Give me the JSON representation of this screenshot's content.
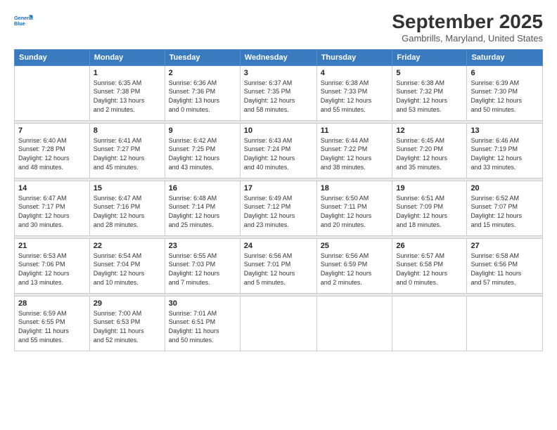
{
  "logo": {
    "line1": "General",
    "line2": "Blue"
  },
  "title": "September 2025",
  "subtitle": "Gambrills, Maryland, United States",
  "weekdays": [
    "Sunday",
    "Monday",
    "Tuesday",
    "Wednesday",
    "Thursday",
    "Friday",
    "Saturday"
  ],
  "weeks": [
    [
      {
        "day": "",
        "info": ""
      },
      {
        "day": "1",
        "info": "Sunrise: 6:35 AM\nSunset: 7:38 PM\nDaylight: 13 hours\nand 2 minutes."
      },
      {
        "day": "2",
        "info": "Sunrise: 6:36 AM\nSunset: 7:36 PM\nDaylight: 13 hours\nand 0 minutes."
      },
      {
        "day": "3",
        "info": "Sunrise: 6:37 AM\nSunset: 7:35 PM\nDaylight: 12 hours\nand 58 minutes."
      },
      {
        "day": "4",
        "info": "Sunrise: 6:38 AM\nSunset: 7:33 PM\nDaylight: 12 hours\nand 55 minutes."
      },
      {
        "day": "5",
        "info": "Sunrise: 6:38 AM\nSunset: 7:32 PM\nDaylight: 12 hours\nand 53 minutes."
      },
      {
        "day": "6",
        "info": "Sunrise: 6:39 AM\nSunset: 7:30 PM\nDaylight: 12 hours\nand 50 minutes."
      }
    ],
    [
      {
        "day": "7",
        "info": "Sunrise: 6:40 AM\nSunset: 7:28 PM\nDaylight: 12 hours\nand 48 minutes."
      },
      {
        "day": "8",
        "info": "Sunrise: 6:41 AM\nSunset: 7:27 PM\nDaylight: 12 hours\nand 45 minutes."
      },
      {
        "day": "9",
        "info": "Sunrise: 6:42 AM\nSunset: 7:25 PM\nDaylight: 12 hours\nand 43 minutes."
      },
      {
        "day": "10",
        "info": "Sunrise: 6:43 AM\nSunset: 7:24 PM\nDaylight: 12 hours\nand 40 minutes."
      },
      {
        "day": "11",
        "info": "Sunrise: 6:44 AM\nSunset: 7:22 PM\nDaylight: 12 hours\nand 38 minutes."
      },
      {
        "day": "12",
        "info": "Sunrise: 6:45 AM\nSunset: 7:20 PM\nDaylight: 12 hours\nand 35 minutes."
      },
      {
        "day": "13",
        "info": "Sunrise: 6:46 AM\nSunset: 7:19 PM\nDaylight: 12 hours\nand 33 minutes."
      }
    ],
    [
      {
        "day": "14",
        "info": "Sunrise: 6:47 AM\nSunset: 7:17 PM\nDaylight: 12 hours\nand 30 minutes."
      },
      {
        "day": "15",
        "info": "Sunrise: 6:47 AM\nSunset: 7:16 PM\nDaylight: 12 hours\nand 28 minutes."
      },
      {
        "day": "16",
        "info": "Sunrise: 6:48 AM\nSunset: 7:14 PM\nDaylight: 12 hours\nand 25 minutes."
      },
      {
        "day": "17",
        "info": "Sunrise: 6:49 AM\nSunset: 7:12 PM\nDaylight: 12 hours\nand 23 minutes."
      },
      {
        "day": "18",
        "info": "Sunrise: 6:50 AM\nSunset: 7:11 PM\nDaylight: 12 hours\nand 20 minutes."
      },
      {
        "day": "19",
        "info": "Sunrise: 6:51 AM\nSunset: 7:09 PM\nDaylight: 12 hours\nand 18 minutes."
      },
      {
        "day": "20",
        "info": "Sunrise: 6:52 AM\nSunset: 7:07 PM\nDaylight: 12 hours\nand 15 minutes."
      }
    ],
    [
      {
        "day": "21",
        "info": "Sunrise: 6:53 AM\nSunset: 7:06 PM\nDaylight: 12 hours\nand 13 minutes."
      },
      {
        "day": "22",
        "info": "Sunrise: 6:54 AM\nSunset: 7:04 PM\nDaylight: 12 hours\nand 10 minutes."
      },
      {
        "day": "23",
        "info": "Sunrise: 6:55 AM\nSunset: 7:03 PM\nDaylight: 12 hours\nand 7 minutes."
      },
      {
        "day": "24",
        "info": "Sunrise: 6:56 AM\nSunset: 7:01 PM\nDaylight: 12 hours\nand 5 minutes."
      },
      {
        "day": "25",
        "info": "Sunrise: 6:56 AM\nSunset: 6:59 PM\nDaylight: 12 hours\nand 2 minutes."
      },
      {
        "day": "26",
        "info": "Sunrise: 6:57 AM\nSunset: 6:58 PM\nDaylight: 12 hours\nand 0 minutes."
      },
      {
        "day": "27",
        "info": "Sunrise: 6:58 AM\nSunset: 6:56 PM\nDaylight: 11 hours\nand 57 minutes."
      }
    ],
    [
      {
        "day": "28",
        "info": "Sunrise: 6:59 AM\nSunset: 6:55 PM\nDaylight: 11 hours\nand 55 minutes."
      },
      {
        "day": "29",
        "info": "Sunrise: 7:00 AM\nSunset: 6:53 PM\nDaylight: 11 hours\nand 52 minutes."
      },
      {
        "day": "30",
        "info": "Sunrise: 7:01 AM\nSunset: 6:51 PM\nDaylight: 11 hours\nand 50 minutes."
      },
      {
        "day": "",
        "info": ""
      },
      {
        "day": "",
        "info": ""
      },
      {
        "day": "",
        "info": ""
      },
      {
        "day": "",
        "info": ""
      }
    ]
  ]
}
